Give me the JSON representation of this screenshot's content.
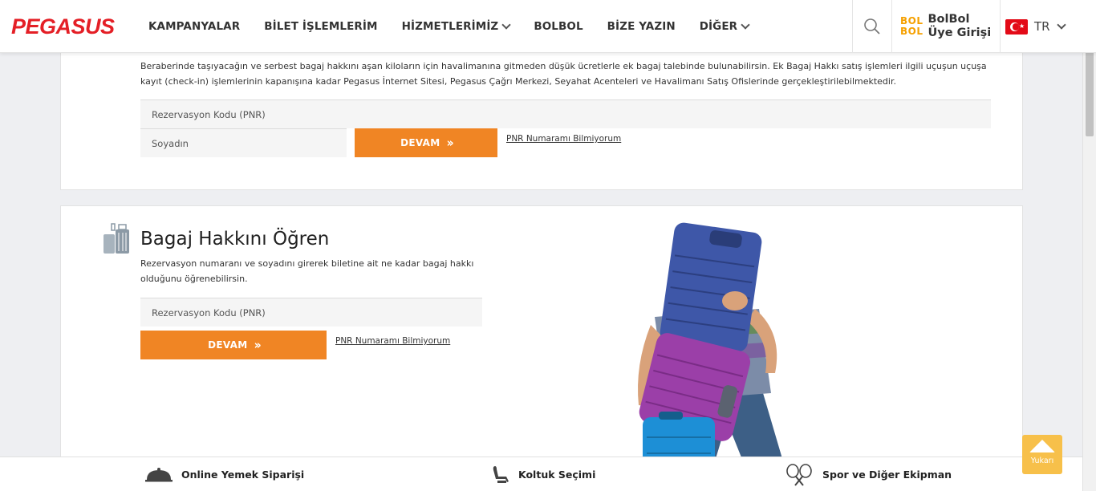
{
  "header": {
    "logo": "PEGASUS",
    "nav": [
      {
        "label": "KAMPANYALAR",
        "dropdown": false
      },
      {
        "label": "BİLET İŞLEMLERİM",
        "dropdown": false
      },
      {
        "label": "HİZMETLERİMİZ",
        "dropdown": true
      },
      {
        "label": "BOLBOL",
        "dropdown": false
      },
      {
        "label": "BİZE YAZIN",
        "dropdown": false
      },
      {
        "label": "DİĞER",
        "dropdown": true
      }
    ],
    "bolbol_logo_line1": "BOL",
    "bolbol_logo_line2": "BOL",
    "bolbol_line1": "BolBol",
    "bolbol_line2": "Üye Girişi",
    "language": "TR"
  },
  "extra_baggage": {
    "description": "Beraberinde taşıyacağın ve serbest bagaj hakkını aşan kiloların için havalimanına gitmeden düşük ücretlerle ek bagaj talebinde bulunabilirsin. Ek Bagaj Hakkı satış işlemleri ilgili uçuşun uçuşa kayıt (check-in) işlemlerinin kapanışına kadar Pegasus İnternet Sitesi, Pegasus Çağrı Merkezi, Seyahat Acenteleri ve Havalimanı Satış Ofislerinde gerçekleştirilebilmektedir.",
    "pnr_placeholder": "Rezervasyon Kodu (PNR)",
    "surname_placeholder": "Soyadın",
    "button": "DEVAM",
    "forgot_link": "PNR Numaramı Bilmiyorum"
  },
  "baggage_allowance": {
    "title": "Bagaj Hakkını Öğren",
    "description": "Rezervasyon numaranı ve soyadını girerek biletine ait ne kadar bagaj hakkı olduğunu öğrenebilirsin.",
    "pnr_placeholder": "Rezervasyon Kodu (PNR)",
    "button": "DEVAM",
    "forgot_link": "PNR Numaramı Bilmiyorum"
  },
  "bottom_bar": [
    {
      "label": "Online Yemek Siparişi",
      "icon": "cloche-icon"
    },
    {
      "label": "Koltuk Seçimi",
      "icon": "seat-icon"
    },
    {
      "label": "Spor ve Diğer Ekipman",
      "icon": "rackets-icon"
    }
  ],
  "back_to_top": "Yukarı",
  "colors": {
    "brand_red": "#e41f26",
    "button_orange": "#f08524",
    "bolbol_orange": "#f5a000",
    "totop_yellow": "#f7c04a"
  }
}
